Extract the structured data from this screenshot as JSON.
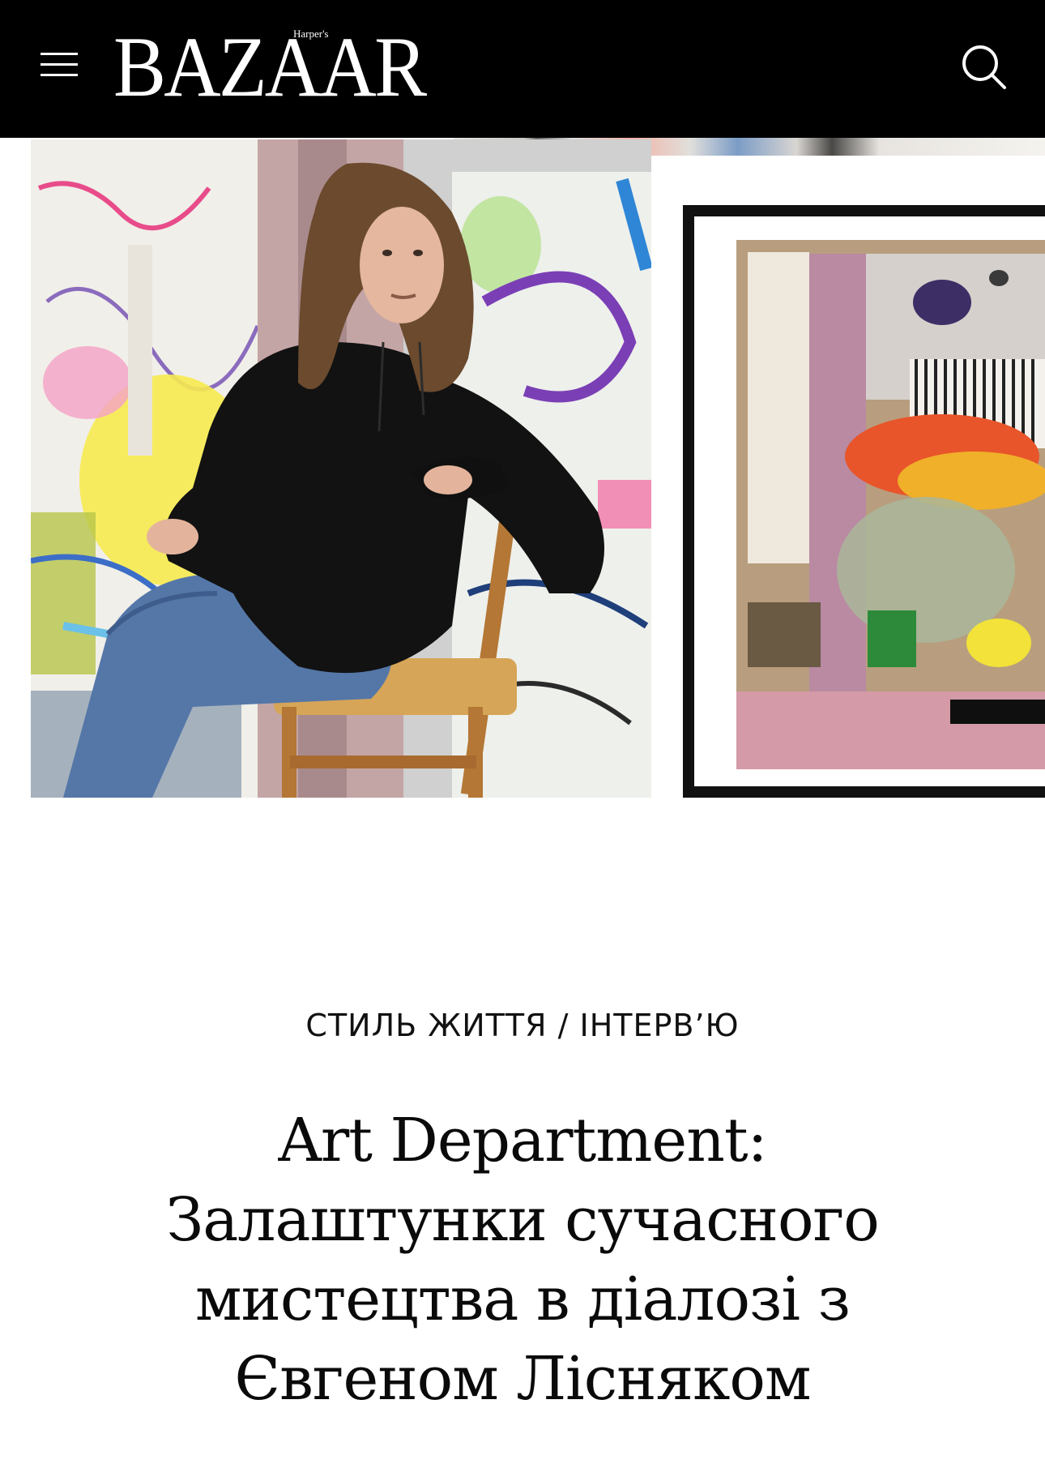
{
  "header": {
    "logo_main": "BAZAAR",
    "logo_small": "Harper's",
    "menu_icon": "hamburger-menu-icon",
    "search_icon": "search-icon",
    "background": "#000000",
    "foreground": "#ffffff"
  },
  "hero": {
    "images": [
      {
        "name": "artist-portrait-photo",
        "description_icon": "photo"
      },
      {
        "name": "framed-abstract-painting",
        "description_icon": "painting"
      }
    ]
  },
  "article": {
    "category_primary": "СТИЛЬ ЖИТТЯ",
    "category_separator": "/",
    "category_secondary": "ІНТЕРВ’Ю",
    "title": "Art Department: Залаштунки сучасного мистецтва в діалозі з Євгеном Лісняком"
  }
}
